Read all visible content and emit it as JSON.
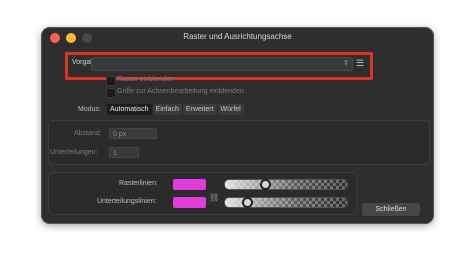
{
  "window": {
    "title": "Raster und Ausrichtungsachse"
  },
  "preset": {
    "label": "Vorgabe:",
    "value": ""
  },
  "checkboxes": [
    {
      "label": "Raster einblenden",
      "checked": false
    },
    {
      "label": "Griffe zur Achsenbearbeitung einblenden",
      "checked": false
    }
  ],
  "mode": {
    "label": "Modus:",
    "options": [
      "Automatisch",
      "Einfach",
      "Erweitert",
      "Würfel"
    ],
    "selected": "Automatisch"
  },
  "spacing": {
    "label": "Abstand:",
    "value": "0 px"
  },
  "subdivisions": {
    "label": "Unterteilungen:",
    "value": "1"
  },
  "grid_lines": {
    "label": "Rasterlinien:",
    "color": "#e23bdc",
    "opacity": 0.33
  },
  "subdivision_lines": {
    "label": "Unterteilungslinien:",
    "color": "#e23bdc",
    "opacity": 0.18
  },
  "close_button": {
    "label": "Schließen"
  },
  "colors": {
    "accent_highlight": "#e0321f",
    "swatch": "#e23bdc"
  }
}
